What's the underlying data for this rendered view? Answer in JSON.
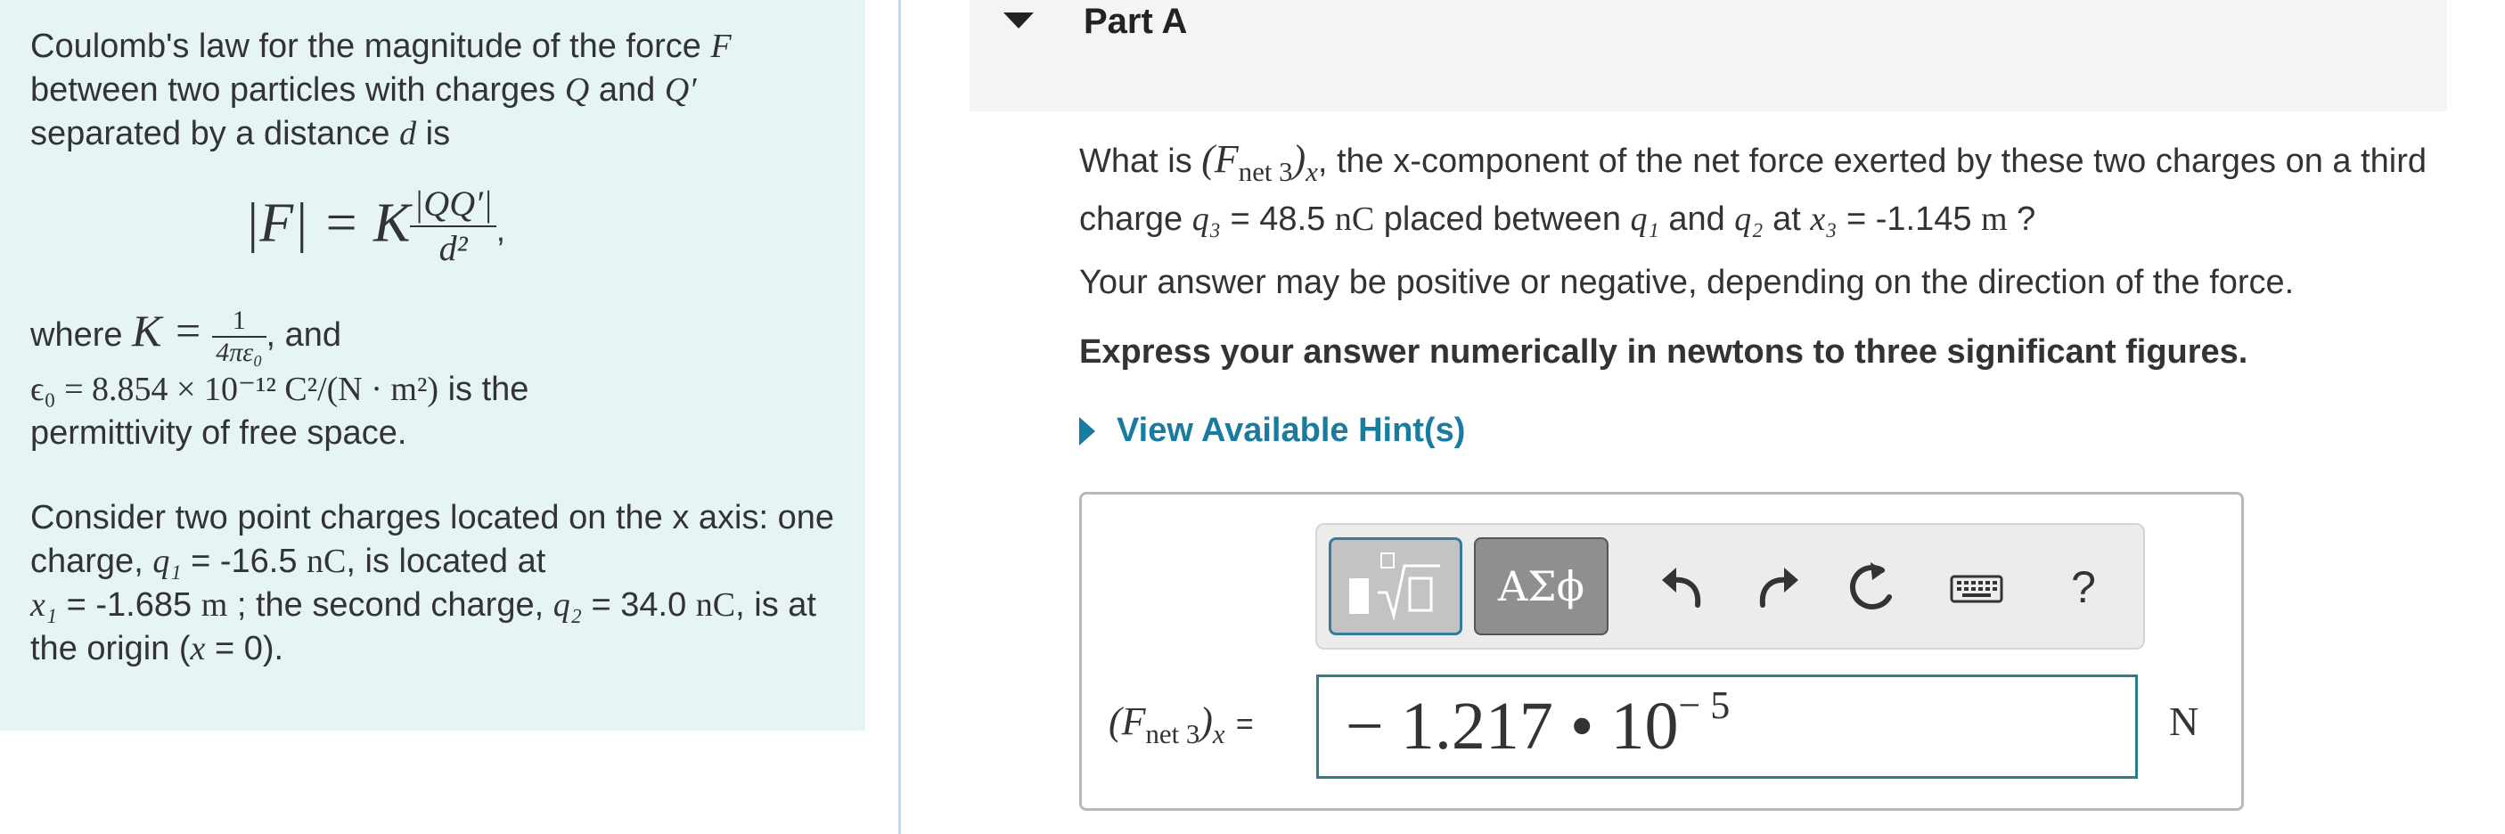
{
  "left_panel": {
    "intro_1": "Coulomb's law for the magnitude of the force",
    "intro_F": "F",
    "intro_2": "between two particles with charges",
    "intro_Q": "Q",
    "intro_and": "and",
    "intro_Qp": "Q′",
    "intro_3": "separated by a distance",
    "intro_d": "d",
    "intro_is": "is",
    "formula_lhs": "|F| = K",
    "formula_num": "|QQ′|",
    "formula_den": "d²",
    "formula_comma": ",",
    "where": "where",
    "K": "K =",
    "K_num": "1",
    "K_den": "4πε₀",
    "and": ", and",
    "epsilon_expr": "ϵ₀ = 8.854 × 10⁻¹² C²/(N · m²)",
    "is_the": "is the",
    "permittivity": "permittivity of free space.",
    "consider": "Consider two point charges located on the x axis: one charge,",
    "q1_label": "q₁",
    "q1_val": "= -16.5",
    "q1_unit": "nC",
    "located": ", is located at",
    "x1_label": "x₁",
    "x1_val": "= -1.685",
    "x1_unit": "m",
    "second": "; the second charge,",
    "q2_label": "q₂",
    "q2_val": "= 34.0",
    "q2_unit": "nC",
    "origin": ", is at the origin (",
    "origin_x": "x",
    "origin_end": "= 0)."
  },
  "part": {
    "title": "Part A"
  },
  "question": {
    "what_is": "What is",
    "fnet": "(F",
    "fnet_sub": "net 3",
    "fnet_close": ")",
    "fnet_x": "x",
    "text1": ", the x-component of the net force exerted by these two charges on a third charge",
    "q3": "q₃",
    "q3_val": "= 48.5",
    "q3_unit": "nC",
    "text2": "placed between",
    "q1": "q₁",
    "and": "and",
    "q2": "q₂",
    "at": "at",
    "x3": "x₃",
    "x3_val": "= -1.145",
    "x3_unit": "m",
    "qmark": "?",
    "advice": "Your answer may be positive or negative, depending on the direction of the force.",
    "instruction": "Express your answer numerically in newtons to three significant figures.",
    "hints": "View Available Hint(s)"
  },
  "toolbar": {
    "symbols_label": "ΑΣϕ",
    "help_label": "?",
    "icons": [
      "template-icon",
      "undo-icon",
      "redo-icon",
      "reset-icon",
      "keyboard-icon",
      "help-icon"
    ]
  },
  "answer": {
    "label_F": "(F",
    "label_sub": "net 3",
    "label_close": ")",
    "label_x": "x",
    "label_eq": "=",
    "value_mantissa": "− 1.217 • 10",
    "value_exponent": "− 5",
    "unit": "N"
  }
}
